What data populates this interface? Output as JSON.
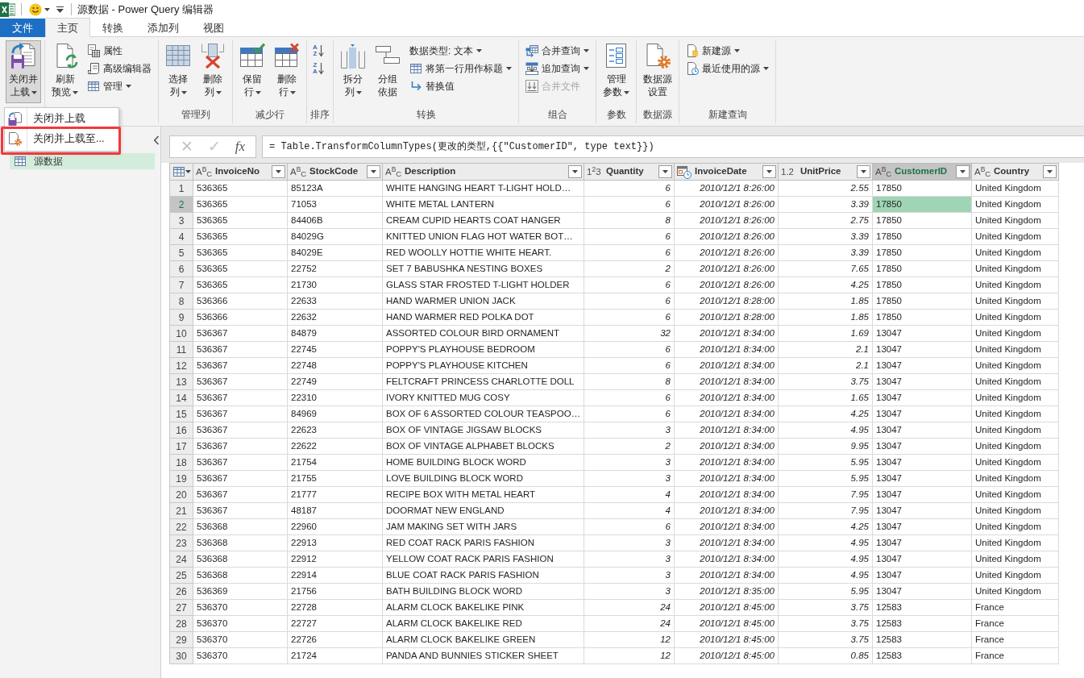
{
  "window": {
    "title": "源数据 - Power Query 编辑器"
  },
  "tabs": [
    {
      "label": "文件",
      "kind": "file",
      "selected": false
    },
    {
      "label": "主页",
      "kind": "tab",
      "selected": true
    },
    {
      "label": "转换",
      "kind": "tab",
      "selected": false
    },
    {
      "label": "添加列",
      "kind": "tab",
      "selected": false
    },
    {
      "label": "视图",
      "kind": "tab",
      "selected": false
    }
  ],
  "ribbon": {
    "groups": [
      {
        "items": [
          {
            "kind": "large",
            "label_lines": [
              "关闭并",
              "上载"
            ],
            "has_menu": true,
            "expanded": true,
            "disabled": false,
            "menu": [
              {
                "label": "关闭并上载",
                "highlighted": false
              },
              {
                "label": "关闭并上载至...",
                "highlighted": true
              }
            ]
          }
        ]
      },
      {
        "items": [
          {
            "kind": "large",
            "label_lines": [
              "刷新",
              "预览"
            ],
            "has_menu": true,
            "expanded": false,
            "disabled": false
          },
          {
            "kind": "small",
            "label": "属性",
            "has_menu": false,
            "expanded": false,
            "disabled": false
          },
          {
            "kind": "small",
            "label": "高级编辑器",
            "has_menu": false,
            "expanded": false,
            "disabled": false
          },
          {
            "kind": "small",
            "label": "管理",
            "has_menu": true,
            "expanded": false,
            "disabled": false
          }
        ]
      },
      {
        "label": "管理列",
        "items": [
          {
            "kind": "large",
            "label_lines": [
              "选择",
              "列"
            ],
            "has_menu": true,
            "expanded": false,
            "disabled": false
          },
          {
            "kind": "large",
            "label_lines": [
              "删除",
              "列"
            ],
            "has_menu": true,
            "expanded": false,
            "disabled": false
          }
        ]
      },
      {
        "label": "减少行",
        "items": [
          {
            "kind": "large",
            "label_lines": [
              "保留",
              "行"
            ],
            "has_menu": true,
            "expanded": false,
            "disabled": false
          },
          {
            "kind": "large",
            "label_lines": [
              "删除",
              "行"
            ],
            "has_menu": true,
            "expanded": false,
            "disabled": false
          }
        ]
      },
      {
        "label": "排序",
        "items": [
          {
            "kind": "sort",
            "letters": [
              "A",
              "Z"
            ],
            "has_menu": false,
            "expanded": false,
            "disabled": false
          },
          {
            "kind": "sort",
            "letters": [
              "Z",
              "A"
            ],
            "has_menu": false,
            "expanded": false,
            "disabled": false
          }
        ]
      },
      {
        "label": "转换",
        "items": [
          {
            "kind": "large",
            "label_lines": [
              "拆分",
              "列"
            ],
            "has_menu": true,
            "expanded": false,
            "disabled": false
          },
          {
            "kind": "large",
            "label_lines": [
              "分组",
              "依据"
            ],
            "has_menu": false,
            "expanded": false,
            "disabled": false
          },
          {
            "kind": "small",
            "label": "数据类型: 文本",
            "has_menu": true,
            "expanded": false,
            "disabled": false
          },
          {
            "kind": "small",
            "label": "将第一行用作标题",
            "has_menu": true,
            "expanded": false,
            "disabled": false
          },
          {
            "kind": "small",
            "label": "替换值",
            "has_menu": false,
            "expanded": false,
            "disabled": false
          }
        ]
      },
      {
        "label": "组合",
        "items": [
          {
            "kind": "small",
            "label": "合并查询",
            "has_menu": true,
            "expanded": false,
            "disabled": false
          },
          {
            "kind": "small",
            "label": "追加查询",
            "has_menu": true,
            "expanded": false,
            "disabled": false
          },
          {
            "kind": "small",
            "label": "合并文件",
            "has_menu": false,
            "expanded": false,
            "disabled": true
          }
        ]
      },
      {
        "label": "参数",
        "items": [
          {
            "kind": "large",
            "label_lines": [
              "管理",
              "参数"
            ],
            "has_menu": true,
            "expanded": false,
            "disabled": false
          }
        ]
      },
      {
        "label": "数据源",
        "items": [
          {
            "kind": "large",
            "label_lines": [
              "数据源",
              "设置"
            ],
            "has_menu": false,
            "expanded": false,
            "disabled": false
          }
        ]
      },
      {
        "label": "新建查询",
        "items": [
          {
            "kind": "small",
            "label": "新建源",
            "has_menu": true,
            "expanded": false,
            "disabled": false
          },
          {
            "kind": "small",
            "label": "最近使用的源",
            "has_menu": true,
            "expanded": false,
            "disabled": false
          }
        ]
      }
    ]
  },
  "queries_pane": {
    "items": [
      {
        "label": "源数据",
        "selected": true
      }
    ]
  },
  "formula_bar": {
    "cancel": {
      "glyph": "✕",
      "disabled": true
    },
    "commit": {
      "glyph": "✓",
      "disabled": true
    },
    "function": {
      "glyph": "fx",
      "disabled": false
    },
    "formula": "= Table.TransformColumnTypes(更改的类型,{{\"CustomerID\", type text}})"
  },
  "table": {
    "columns": [
      {
        "name": "InvoiceNo",
        "kind": "text",
        "type_glyph": "A$^{B}$$_{C}$",
        "selected": false
      },
      {
        "name": "StockCode",
        "kind": "text",
        "type_glyph": "A$^{B}$$_{C}$",
        "selected": false
      },
      {
        "name": "Description",
        "kind": "text",
        "type_glyph": "A$^{B}$$_{C}$",
        "selected": false
      },
      {
        "name": "Quantity",
        "kind": "whole",
        "type_glyph": "1$^{2}$3",
        "selected": false
      },
      {
        "name": "InvoiceDate",
        "kind": "datetime",
        "selected": false
      },
      {
        "name": "UnitPrice",
        "kind": "decimal",
        "type_glyph": "1.2",
        "selected": false
      },
      {
        "name": "CustomerID",
        "kind": "text",
        "type_glyph": "A$^{B}$$_{C}$",
        "selected": true
      },
      {
        "name": "Country",
        "kind": "text",
        "type_glyph": "A$^{B}$$_{C}$",
        "selected": false
      }
    ],
    "rows": [
      {
        "number": "1",
        "selected": false,
        "cells": [
          "536365",
          "85123A",
          "WHITE HANGING HEART T-LIGHT HOLD…",
          "6",
          "2010/12/1 8:26:00",
          "2.55",
          "17850",
          "United Kingdom"
        ]
      },
      {
        "number": "2",
        "selected": true,
        "cells": [
          "536365",
          "71053",
          "WHITE METAL LANTERN",
          "6",
          "2010/12/1 8:26:00",
          "3.39",
          "17850",
          "United Kingdom"
        ]
      },
      {
        "number": "3",
        "selected": false,
        "cells": [
          "536365",
          "84406B",
          "CREAM CUPID HEARTS COAT HANGER",
          "8",
          "2010/12/1 8:26:00",
          "2.75",
          "17850",
          "United Kingdom"
        ]
      },
      {
        "number": "4",
        "selected": false,
        "cells": [
          "536365",
          "84029G",
          "KNITTED UNION FLAG HOT WATER BOT…",
          "6",
          "2010/12/1 8:26:00",
          "3.39",
          "17850",
          "United Kingdom"
        ]
      },
      {
        "number": "5",
        "selected": false,
        "cells": [
          "536365",
          "84029E",
          "RED WOOLLY HOTTIE WHITE HEART.",
          "6",
          "2010/12/1 8:26:00",
          "3.39",
          "17850",
          "United Kingdom"
        ]
      },
      {
        "number": "6",
        "selected": false,
        "cells": [
          "536365",
          "22752",
          "SET 7 BABUSHKA NESTING BOXES",
          "2",
          "2010/12/1 8:26:00",
          "7.65",
          "17850",
          "United Kingdom"
        ]
      },
      {
        "number": "7",
        "selected": false,
        "cells": [
          "536365",
          "21730",
          "GLASS STAR FROSTED T-LIGHT HOLDER",
          "6",
          "2010/12/1 8:26:00",
          "4.25",
          "17850",
          "United Kingdom"
        ]
      },
      {
        "number": "8",
        "selected": false,
        "cells": [
          "536366",
          "22633",
          "HAND WARMER UNION JACK",
          "6",
          "2010/12/1 8:28:00",
          "1.85",
          "17850",
          "United Kingdom"
        ]
      },
      {
        "number": "9",
        "selected": false,
        "cells": [
          "536366",
          "22632",
          "HAND WARMER RED POLKA DOT",
          "6",
          "2010/12/1 8:28:00",
          "1.85",
          "17850",
          "United Kingdom"
        ]
      },
      {
        "number": "10",
        "selected": false,
        "cells": [
          "536367",
          "84879",
          "ASSORTED COLOUR BIRD ORNAMENT",
          "32",
          "2010/12/1 8:34:00",
          "1.69",
          "13047",
          "United Kingdom"
        ]
      },
      {
        "number": "11",
        "selected": false,
        "cells": [
          "536367",
          "22745",
          "POPPY'S PLAYHOUSE BEDROOM",
          "6",
          "2010/12/1 8:34:00",
          "2.1",
          "13047",
          "United Kingdom"
        ]
      },
      {
        "number": "12",
        "selected": false,
        "cells": [
          "536367",
          "22748",
          "POPPY'S PLAYHOUSE KITCHEN",
          "6",
          "2010/12/1 8:34:00",
          "2.1",
          "13047",
          "United Kingdom"
        ]
      },
      {
        "number": "13",
        "selected": false,
        "cells": [
          "536367",
          "22749",
          "FELTCRAFT PRINCESS CHARLOTTE DOLL",
          "8",
          "2010/12/1 8:34:00",
          "3.75",
          "13047",
          "United Kingdom"
        ]
      },
      {
        "number": "14",
        "selected": false,
        "cells": [
          "536367",
          "22310",
          "IVORY KNITTED MUG COSY",
          "6",
          "2010/12/1 8:34:00",
          "1.65",
          "13047",
          "United Kingdom"
        ]
      },
      {
        "number": "15",
        "selected": false,
        "cells": [
          "536367",
          "84969",
          "BOX OF 6 ASSORTED COLOUR TEASPOO…",
          "6",
          "2010/12/1 8:34:00",
          "4.25",
          "13047",
          "United Kingdom"
        ]
      },
      {
        "number": "16",
        "selected": false,
        "cells": [
          "536367",
          "22623",
          "BOX OF VINTAGE JIGSAW BLOCKS",
          "3",
          "2010/12/1 8:34:00",
          "4.95",
          "13047",
          "United Kingdom"
        ]
      },
      {
        "number": "17",
        "selected": false,
        "cells": [
          "536367",
          "22622",
          "BOX OF VINTAGE ALPHABET BLOCKS",
          "2",
          "2010/12/1 8:34:00",
          "9.95",
          "13047",
          "United Kingdom"
        ]
      },
      {
        "number": "18",
        "selected": false,
        "cells": [
          "536367",
          "21754",
          "HOME BUILDING BLOCK WORD",
          "3",
          "2010/12/1 8:34:00",
          "5.95",
          "13047",
          "United Kingdom"
        ]
      },
      {
        "number": "19",
        "selected": false,
        "cells": [
          "536367",
          "21755",
          "LOVE BUILDING BLOCK WORD",
          "3",
          "2010/12/1 8:34:00",
          "5.95",
          "13047",
          "United Kingdom"
        ]
      },
      {
        "number": "20",
        "selected": false,
        "cells": [
          "536367",
          "21777",
          "RECIPE BOX WITH METAL HEART",
          "4",
          "2010/12/1 8:34:00",
          "7.95",
          "13047",
          "United Kingdom"
        ]
      },
      {
        "number": "21",
        "selected": false,
        "cells": [
          "536367",
          "48187",
          "DOORMAT NEW ENGLAND",
          "4",
          "2010/12/1 8:34:00",
          "7.95",
          "13047",
          "United Kingdom"
        ]
      },
      {
        "number": "22",
        "selected": false,
        "cells": [
          "536368",
          "22960",
          "JAM MAKING SET WITH JARS",
          "6",
          "2010/12/1 8:34:00",
          "4.25",
          "13047",
          "United Kingdom"
        ]
      },
      {
        "number": "23",
        "selected": false,
        "cells": [
          "536368",
          "22913",
          "RED COAT RACK PARIS FASHION",
          "3",
          "2010/12/1 8:34:00",
          "4.95",
          "13047",
          "United Kingdom"
        ]
      },
      {
        "number": "24",
        "selected": false,
        "cells": [
          "536368",
          "22912",
          "YELLOW COAT RACK PARIS FASHION",
          "3",
          "2010/12/1 8:34:00",
          "4.95",
          "13047",
          "United Kingdom"
        ]
      },
      {
        "number": "25",
        "selected": false,
        "cells": [
          "536368",
          "22914",
          "BLUE COAT RACK PARIS FASHION",
          "3",
          "2010/12/1 8:34:00",
          "4.95",
          "13047",
          "United Kingdom"
        ]
      },
      {
        "number": "26",
        "selected": false,
        "cells": [
          "536369",
          "21756",
          "BATH BUILDING BLOCK WORD",
          "3",
          "2010/12/1 8:35:00",
          "5.95",
          "13047",
          "United Kingdom"
        ]
      },
      {
        "number": "27",
        "selected": false,
        "cells": [
          "536370",
          "22728",
          "ALARM CLOCK BAKELIKE PINK",
          "24",
          "2010/12/1 8:45:00",
          "3.75",
          "12583",
          "France"
        ]
      },
      {
        "number": "28",
        "selected": false,
        "cells": [
          "536370",
          "22727",
          "ALARM CLOCK BAKELIKE RED",
          "24",
          "2010/12/1 8:45:00",
          "3.75",
          "12583",
          "France"
        ]
      },
      {
        "number": "29",
        "selected": false,
        "cells": [
          "536370",
          "22726",
          "ALARM CLOCK BAKELIKE GREEN",
          "12",
          "2010/12/1 8:45:00",
          "3.75",
          "12583",
          "France"
        ]
      },
      {
        "number": "30",
        "selected": false,
        "cells": [
          "536370",
          "21724",
          "PANDA AND BUNNIES STICKER SHEET",
          "12",
          "2010/12/1 8:45:00",
          "0.85",
          "12583",
          "France"
        ]
      }
    ]
  }
}
